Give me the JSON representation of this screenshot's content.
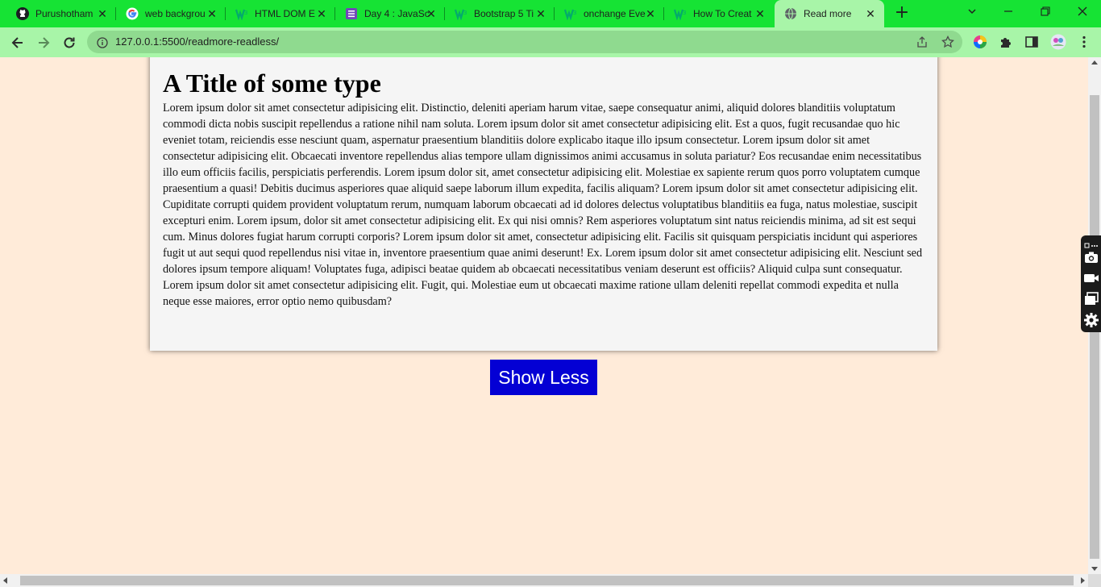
{
  "browser": {
    "tabs": [
      {
        "title": "Purushotham",
        "icon": "github-icon",
        "active": false
      },
      {
        "title": "web backgrou",
        "icon": "google-icon",
        "active": false
      },
      {
        "title": "HTML DOM E",
        "icon": "w3schools-icon",
        "active": false
      },
      {
        "title": "Day 4 : JavaSc",
        "icon": "form-icon",
        "active": false
      },
      {
        "title": "Bootstrap 5 Ti",
        "icon": "w3schools-icon",
        "active": false
      },
      {
        "title": "onchange Eve",
        "icon": "w3schools-icon",
        "active": false
      },
      {
        "title": "How To Creat",
        "icon": "w3schools-icon",
        "active": false
      },
      {
        "title": "Read more",
        "icon": "globe-icon",
        "active": true
      }
    ],
    "url": "127.0.0.1:5500/readmore-readless/"
  },
  "colors": {
    "tabstrip": "#16e334",
    "toolbar": "#a8f5a8",
    "page_bg": "#ffebd9",
    "card_bg": "#f5f5f5",
    "button_bg": "#0400d4"
  },
  "page": {
    "title": "A Title of some type",
    "body": "Lorem ipsum dolor sit amet consectetur adipisicing elit. Distinctio, deleniti aperiam harum vitae, saepe consequatur animi, aliquid dolores blanditiis voluptatum commodi dicta nobis suscipit repellendus a ratione nihil nam soluta. Lorem ipsum dolor sit amet consectetur adipisicing elit. Est a quos, fugit recusandae quo hic eveniet totam, reiciendis esse nesciunt quam, aspernatur praesentium blanditiis dolore explicabo itaque illo ipsum consectetur. Lorem ipsum dolor sit amet consectetur adipisicing elit. Obcaecati inventore repellendus alias tempore ullam dignissimos animi accusamus in soluta pariatur? Eos recusandae enim necessitatibus illo eum officiis facilis, perspiciatis perferendis. Lorem ipsum dolor sit, amet consectetur adipisicing elit. Molestiae ex sapiente rerum quos porro voluptatem cumque praesentium a quasi! Debitis ducimus asperiores quae aliquid saepe laborum illum expedita, facilis aliquam? Lorem ipsum dolor sit amet consectetur adipisicing elit. Cupiditate corrupti quidem provident voluptatum rerum, numquam laborum obcaecati ad id dolores delectus voluptatibus blanditiis ea fuga, natus molestiae, suscipit excepturi enim. Lorem ipsum, dolor sit amet consectetur adipisicing elit. Ex qui nisi omnis? Rem asperiores voluptatum sint natus reiciendis minima, ad sit est sequi cum. Minus dolores fugiat harum corrupti corporis? Lorem ipsum dolor sit amet, consectetur adipisicing elit. Facilis sit quisquam perspiciatis incidunt qui asperiores fugit ut aut sequi quod repellendus nisi vitae in, inventore praesentium quae animi deserunt! Ex. Lorem ipsum dolor sit amet consectetur adipisicing elit. Nesciunt sed dolores ipsum tempore aliquam! Voluptates fuga, adipisci beatae quidem ab obcaecati necessitatibus veniam deserunt est officiis? Aliquid culpa sunt consequatur. Lorem ipsum dolor sit amet consectetur adipisicing elit. Fugit, qui. Molestiae eum ut obcaecati maxime ratione ullam deleniti repellat commodi expedita et nulla neque esse maiores, error optio nemo quibusdam?",
    "button_label": "Show Less"
  }
}
